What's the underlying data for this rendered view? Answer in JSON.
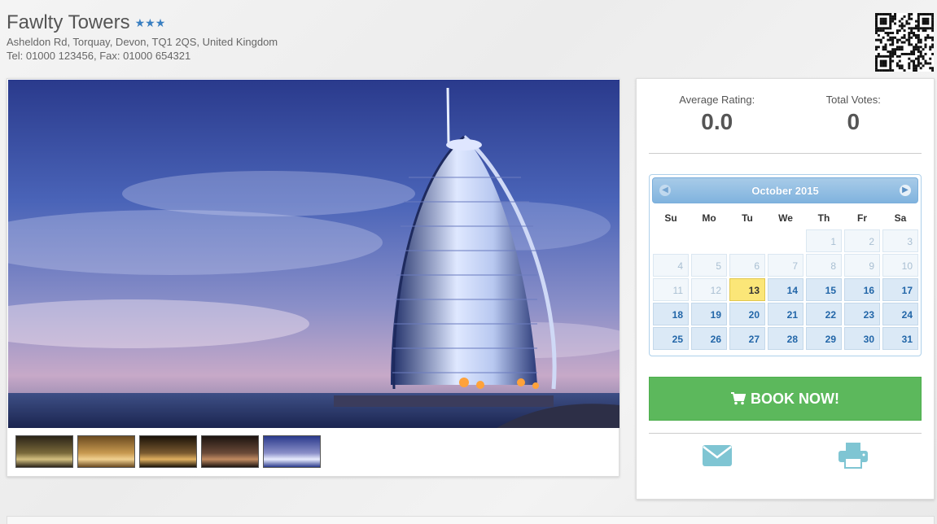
{
  "hotel": {
    "name": "Fawlty Towers",
    "stars": "★★★",
    "address": "Asheldon Rd, Torquay, Devon, TQ1 2QS, United Kingdom",
    "contact": "Tel: 01000 123456, Fax: 01000 654321"
  },
  "rating": {
    "average_label": "Average Rating:",
    "average_value": "0.0",
    "votes_label": "Total Votes:",
    "votes_value": "0"
  },
  "calendar": {
    "month_title": "October 2015",
    "weekdays": [
      "Su",
      "Mo",
      "Tu",
      "We",
      "Th",
      "Fr",
      "Sa"
    ],
    "leading_blanks": 4,
    "days_in_month": 31,
    "today": 13
  },
  "booking": {
    "book_label": "BOOK NOW!",
    "cart_icon": "shopping-cart-icon",
    "email_icon": "envelope-icon",
    "print_icon": "printer-icon"
  },
  "gallery": {
    "thumbnail_count": 5,
    "selected_index": 4
  },
  "colors": {
    "book_button": "#5cb85c",
    "star": "#3a7fc1",
    "today_highlight": "#fbe678",
    "icon_teal": "#7fc5d3"
  }
}
